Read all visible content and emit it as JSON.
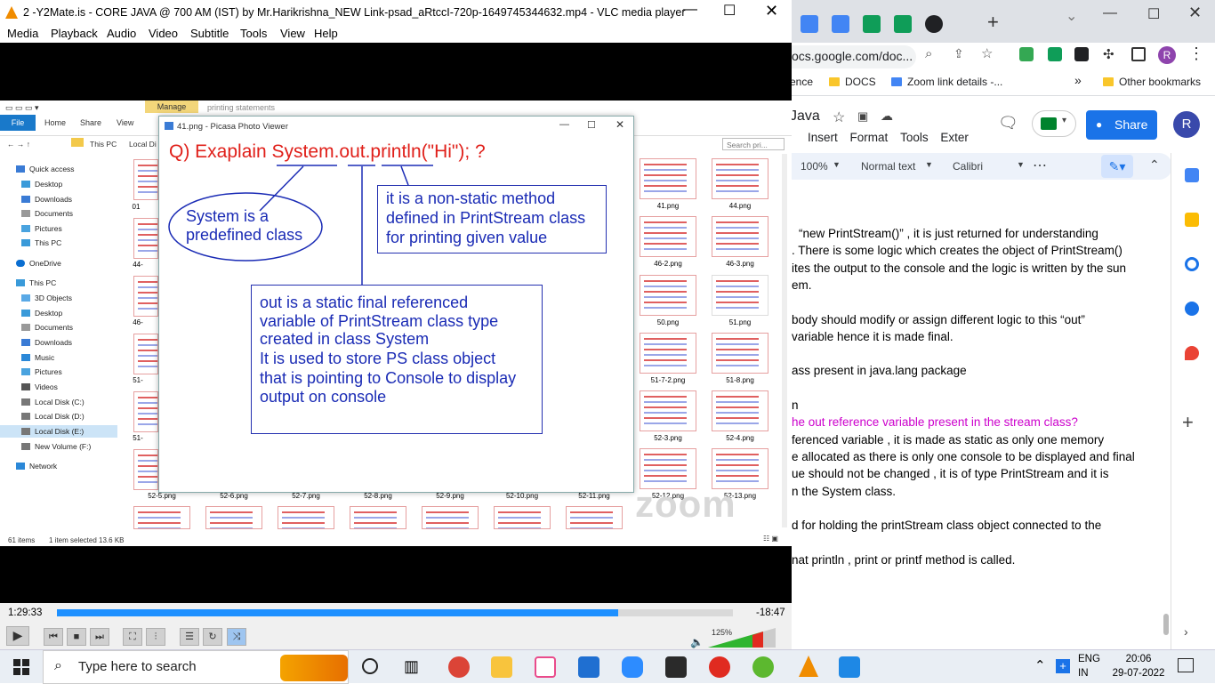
{
  "vlc": {
    "title": "2 -Y2Mate.is - CORE JAVA @ 700 AM (IST) by Mr.Harikrishna_NEW Link-psad_aRtccI-720p-1649745344632.mp4 - VLC media player",
    "menu": [
      "Media",
      "Playback",
      "Audio",
      "Video",
      "Subtitle",
      "Tools",
      "View",
      "Help"
    ],
    "elapsed": "1:29:33",
    "remaining": "-18:47",
    "progress_fraction": 0.83,
    "volume": "125%"
  },
  "explorer": {
    "tabs": [
      "File",
      "Home",
      "Share",
      "View"
    ],
    "manage": "Manage",
    "context": "printing statements",
    "breadcrumb": [
      "This PC",
      "Local Di"
    ],
    "search_placeholder": "Search pri...",
    "nav": [
      "Quick access",
      "Desktop",
      "Downloads",
      "Documents",
      "Pictures",
      "This PC",
      "OneDrive",
      "This PC",
      "3D Objects",
      "Desktop",
      "Documents",
      "Downloads",
      "Music",
      "Pictures",
      "Videos",
      "Local Disk (C:)",
      "Local Disk (D:)",
      "Local Disk (E:)",
      "New Volume (F:)",
      "Network"
    ],
    "thumb_labels_right": [
      "41.png",
      "44.png",
      "46-2.png",
      "46-3.png",
      "50.png",
      "51.png",
      "51-7-2.png",
      "51-8.png",
      "52-3.png",
      "52-4.png",
      "52-12.png",
      "52-13.png"
    ],
    "thumb_labels_left": [
      "01",
      "44-",
      "46-",
      "51-",
      "51-"
    ],
    "thumb_labels_bottom": [
      "52-5.png",
      "52-6.png",
      "52-7.png",
      "52-8.png",
      "52-9.png",
      "52-10.png",
      "52-11.png"
    ],
    "status_items": "61 items",
    "status_selected": "1 item selected  13.6 KB",
    "watermark": "zoom"
  },
  "picasa": {
    "title": "41.png - Picasa Photo Viewer",
    "heading": "Q) Exaplain System.out.println(\"Hi\"); ?",
    "box_system": [
      "System is a",
      "predefined class"
    ],
    "box_println": [
      "it is a non-static method",
      "defined in PrintStream class",
      "for printing given value"
    ],
    "box_out": [
      "out is a static final referenced",
      "variable of PrintStream class type",
      "created in class System",
      "It is used to store PS class object",
      "that is pointing to Console to display",
      "output on console"
    ]
  },
  "chrome": {
    "address": "ocs.google.com/doc...",
    "bookmarks": [
      "ence",
      "DOCS",
      "Zoom link details -...",
      "Other bookmarks"
    ],
    "doc_title": "Java",
    "doc_menu": [
      "Insert",
      "Format",
      "Tools",
      "Exter"
    ],
    "share": "Share",
    "avatar": "R",
    "toolbar": {
      "zoom": "100%",
      "style": "Normal text",
      "font": "Calibri"
    },
    "lines": [
      {
        "text": "“new PrintStream()” , it is just returned for understanding",
        "color": "#000000"
      },
      {
        "text": ". There is some logic which creates the object of PrintStream()",
        "color": "#000000"
      },
      {
        "text": "ites the output to the console and the logic is written by the sun",
        "color": "#000000"
      },
      {
        "text": "em.",
        "color": "#000000"
      },
      {
        "text": "",
        "color": "#000000"
      },
      {
        "text": "body should modify or assign different logic to this “out”",
        "color": "#000000"
      },
      {
        "text": "variable  hence it is made final.",
        "color": "#000000"
      },
      {
        "text": "",
        "color": "#000000"
      },
      {
        "text": "ass present in java.lang package",
        "color": "#000000"
      },
      {
        "text": "",
        "color": "#000000"
      },
      {
        "text": "n",
        "color": "#000000"
      },
      {
        "text": "he out reference variable present in the stream class?",
        "color": "#cc00cc"
      },
      {
        "text": "ferenced variable ,  it is made as static as only one memory",
        "color": "#000000"
      },
      {
        "text": "e allocated as there is only one console to be displayed and final",
        "color": "#000000"
      },
      {
        "text": "ue should not be changed , it is of type PrintStream and it is",
        "color": "#000000"
      },
      {
        "text": "n the System class.",
        "color": "#000000"
      },
      {
        "text": "",
        "color": "#000000"
      },
      {
        "text": "d  for  holding  the  printStream  class  object  connected  to  the",
        "color": "#000000"
      },
      {
        "text": "",
        "color": "#000000"
      },
      {
        "text": "nat println , print or printf method is called.",
        "color": "#000000"
      }
    ]
  },
  "taskbar": {
    "search_placeholder": "Type here to search",
    "lang": "ENG",
    "region": "IN",
    "time": "20:06",
    "date": "29-07-2022"
  }
}
